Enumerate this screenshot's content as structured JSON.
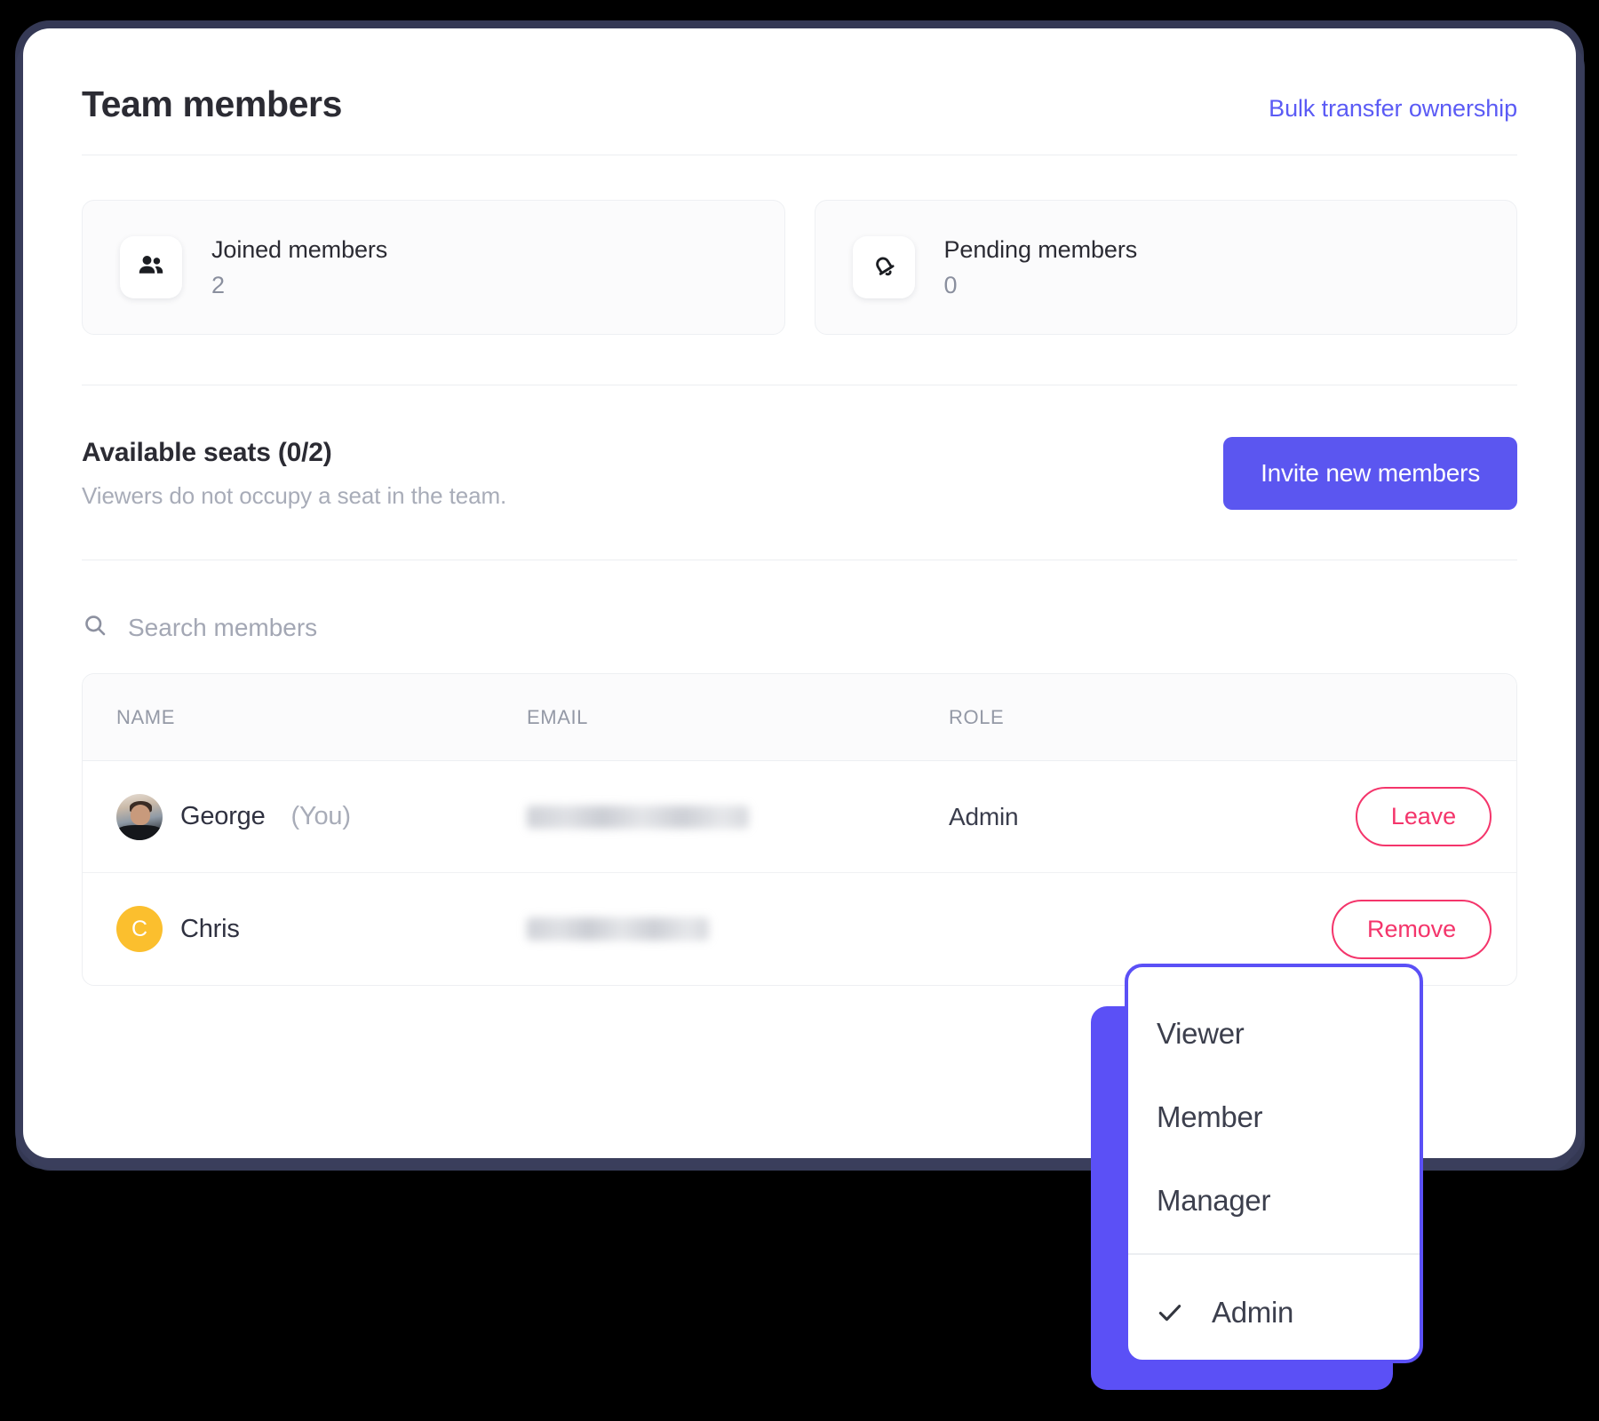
{
  "header": {
    "title": "Team members",
    "bulk_link": "Bulk transfer ownership"
  },
  "stats": [
    {
      "icon": "people-icon",
      "label": "Joined members",
      "value": "2"
    },
    {
      "icon": "bell-icon",
      "label": "Pending members",
      "value": "0"
    }
  ],
  "seats": {
    "title": "Available seats (0/2)",
    "subtitle": "Viewers do not occupy a seat in the team.",
    "invite_label": "Invite new members"
  },
  "search": {
    "icon": "search-icon",
    "placeholder": "Search members",
    "value": ""
  },
  "table": {
    "columns": [
      "NAME",
      "EMAIL",
      "ROLE",
      ""
    ],
    "rows": [
      {
        "name": "George",
        "suffix": "(You)",
        "avatar_type": "photo",
        "avatar_initial": "",
        "email": "",
        "email_redacted": true,
        "role": "Admin",
        "action": "Leave"
      },
      {
        "name": "Chris",
        "suffix": "",
        "avatar_type": "initial",
        "avatar_initial": "C",
        "email": "",
        "email_redacted": true,
        "role": "",
        "action": "Remove"
      }
    ]
  },
  "role_dropdown": {
    "items": [
      {
        "label": "Viewer",
        "checked": false
      },
      {
        "label": "Member",
        "checked": false
      },
      {
        "label": "Manager",
        "checked": false
      },
      {
        "label": "Admin",
        "checked": true
      }
    ],
    "check_icon": "check-icon",
    "selected": "Admin"
  },
  "colors": {
    "accent_indigo": "#5b56f0",
    "link_indigo": "#5b5bf5",
    "danger_pink": "#f4356b",
    "avatar_amber": "#fbbf2e",
    "page_background": "#000000",
    "card_shadow": "#3a3e5c"
  }
}
